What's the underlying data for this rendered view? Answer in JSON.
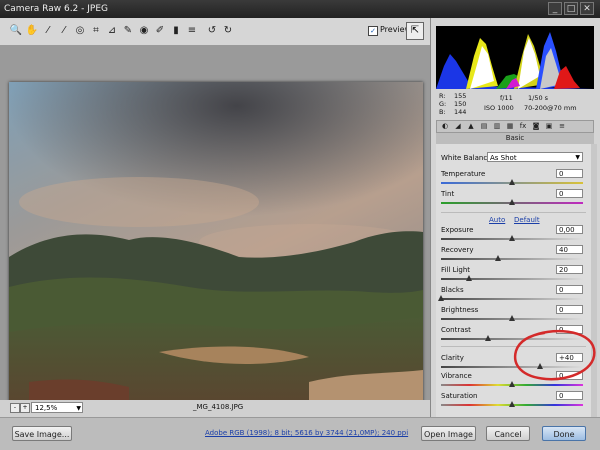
{
  "window": {
    "title": "Camera Raw 6.2  -  JPEG",
    "controls": [
      "_",
      "□",
      "✕"
    ]
  },
  "toolbar": {
    "tools": [
      {
        "name": "zoom-tool-icon",
        "glyph": "🔍"
      },
      {
        "name": "hand-tool-icon",
        "glyph": "✋"
      },
      {
        "name": "white-balance-tool-icon",
        "glyph": "⁄"
      },
      {
        "name": "color-sampler-tool-icon",
        "glyph": "⁄"
      },
      {
        "name": "target-adjustment-tool-icon",
        "glyph": "◎"
      },
      {
        "name": "crop-tool-icon",
        "glyph": "⌗"
      },
      {
        "name": "straighten-tool-icon",
        "glyph": "⊿"
      },
      {
        "name": "spot-removal-tool-icon",
        "glyph": "✎"
      },
      {
        "name": "red-eye-removal-tool-icon",
        "glyph": "◉"
      },
      {
        "name": "adjustment-brush-icon",
        "glyph": "✐"
      },
      {
        "name": "graduated-filter-icon",
        "glyph": "▮"
      },
      {
        "name": "preferences-icon",
        "glyph": "≡"
      },
      {
        "name": "rotate-left-icon",
        "glyph": "↺"
      },
      {
        "name": "rotate-right-icon",
        "glyph": "↻"
      }
    ],
    "preview_label": "Preview",
    "preview_checked": true,
    "fullscreen_glyph": "⇱"
  },
  "image": {
    "zoom_level": "12,5%",
    "filename": "_MG_4108.JPG",
    "nav_prev": "-",
    "nav_next": "+"
  },
  "info": {
    "r_label": "R:",
    "r_value": "155",
    "g_label": "G:",
    "g_value": "150",
    "b_label": "B:",
    "b_value": "144",
    "aperture": "f/11",
    "shutter": "1/50 s",
    "iso": "ISO 1000",
    "lens": "70-200@70 mm"
  },
  "panel_tabs": [
    "◐",
    "◢",
    "▲",
    "▤",
    "▥",
    "▦",
    "fx",
    "◙",
    "▣",
    "≡"
  ],
  "section_title": "Basic",
  "basic": {
    "white_balance_label": "White Balance:",
    "white_balance_value": "As Shot",
    "auto_link": "Auto",
    "default_link": "Default",
    "sliders": [
      {
        "key": "temperature",
        "label": "Temperature",
        "value": "0",
        "level": 0.5,
        "track": "temp"
      },
      {
        "key": "tint",
        "label": "Tint",
        "value": "0",
        "level": 0.5,
        "track": "tint"
      },
      {
        "key": "exposure",
        "label": "Exposure",
        "value": "0,00",
        "level": 0.5,
        "track": "gray"
      },
      {
        "key": "recovery",
        "label": "Recovery",
        "value": "40",
        "level": 0.4,
        "track": "gray"
      },
      {
        "key": "fill-light",
        "label": "Fill Light",
        "value": "20",
        "level": 0.2,
        "track": "gray"
      },
      {
        "key": "blacks",
        "label": "Blacks",
        "value": "0",
        "level": 0.0,
        "track": "gray"
      },
      {
        "key": "brightness",
        "label": "Brightness",
        "value": "0",
        "level": 0.5,
        "track": "gray"
      },
      {
        "key": "contrast",
        "label": "Contrast",
        "value": "0",
        "level": 0.33,
        "track": "gray"
      },
      {
        "key": "clarity",
        "label": "Clarity",
        "value": "+40",
        "level": 0.7,
        "track": "gray"
      },
      {
        "key": "vibrance",
        "label": "Vibrance",
        "value": "0",
        "level": 0.5,
        "track": "vib"
      },
      {
        "key": "saturation",
        "label": "Saturation",
        "value": "0",
        "level": 0.5,
        "track": "sat"
      }
    ]
  },
  "footer": {
    "save_label": "Save Image...",
    "workflow_link": "Adobe RGB (1998); 8 bit; 5616 by 3744 (21,0MP); 240 ppi",
    "open_label": "Open Image",
    "cancel_label": "Cancel",
    "done_label": "Done"
  },
  "colors": {
    "annotation_circle": "#d42a2a",
    "link": "#1a3ea8"
  }
}
